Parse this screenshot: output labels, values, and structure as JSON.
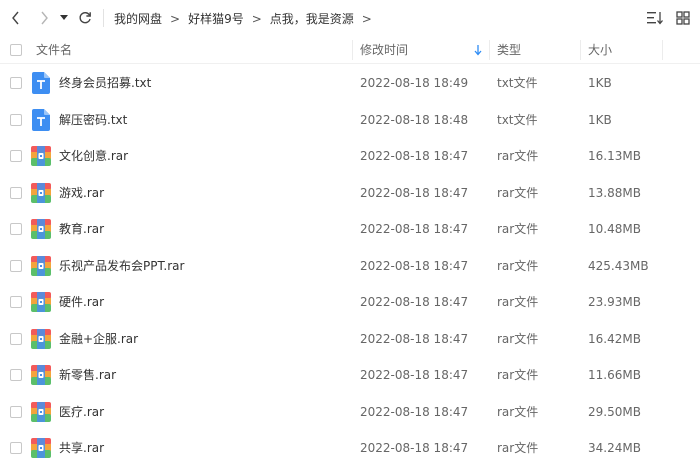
{
  "toolbar": {
    "back_icon": "chevron-left-icon",
    "forward_icon": "chevron-right-icon",
    "history_icon": "caret-down-icon",
    "refresh_icon": "refresh-icon",
    "breadcrumb": [
      "我的网盘",
      "好样猫9号",
      "点我，我是资源"
    ],
    "breadcrumb_sep": ">",
    "sort_icon": "sort-list-icon",
    "grid_icon": "grid-view-icon"
  },
  "header": {
    "name": "文件名",
    "modified": "修改时间",
    "type": "类型",
    "size": "大小",
    "sort_arrow_icon": "arrow-down-icon"
  },
  "colors": {
    "accent": "#2f8df5",
    "txt_icon": "#3d8ef2",
    "rar_top": "#f25a5a",
    "rar_mid": "#f4a43c",
    "rar_bottom": "#5bbf6a",
    "rar_band": "#4a8fe8"
  },
  "files": [
    {
      "name": "终身会员招募.txt",
      "date": "2022-08-18 18:49",
      "type": "txt文件",
      "size": "1KB",
      "icon": "txt-file-icon"
    },
    {
      "name": "解压密码.txt",
      "date": "2022-08-18 18:48",
      "type": "txt文件",
      "size": "1KB",
      "icon": "txt-file-icon"
    },
    {
      "name": "文化创意.rar",
      "date": "2022-08-18 18:47",
      "type": "rar文件",
      "size": "16.13MB",
      "icon": "rar-file-icon"
    },
    {
      "name": "游戏.rar",
      "date": "2022-08-18 18:47",
      "type": "rar文件",
      "size": "13.88MB",
      "icon": "rar-file-icon"
    },
    {
      "name": "教育.rar",
      "date": "2022-08-18 18:47",
      "type": "rar文件",
      "size": "10.48MB",
      "icon": "rar-file-icon"
    },
    {
      "name": "乐视产品发布会PPT.rar",
      "date": "2022-08-18 18:47",
      "type": "rar文件",
      "size": "425.43MB",
      "icon": "rar-file-icon"
    },
    {
      "name": "硬件.rar",
      "date": "2022-08-18 18:47",
      "type": "rar文件",
      "size": "23.93MB",
      "icon": "rar-file-icon"
    },
    {
      "name": "金融+企服.rar",
      "date": "2022-08-18 18:47",
      "type": "rar文件",
      "size": "16.42MB",
      "icon": "rar-file-icon"
    },
    {
      "name": "新零售.rar",
      "date": "2022-08-18 18:47",
      "type": "rar文件",
      "size": "11.66MB",
      "icon": "rar-file-icon"
    },
    {
      "name": "医疗.rar",
      "date": "2022-08-18 18:47",
      "type": "rar文件",
      "size": "29.50MB",
      "icon": "rar-file-icon"
    },
    {
      "name": "共享.rar",
      "date": "2022-08-18 18:47",
      "type": "rar文件",
      "size": "34.24MB",
      "icon": "rar-file-icon"
    }
  ]
}
